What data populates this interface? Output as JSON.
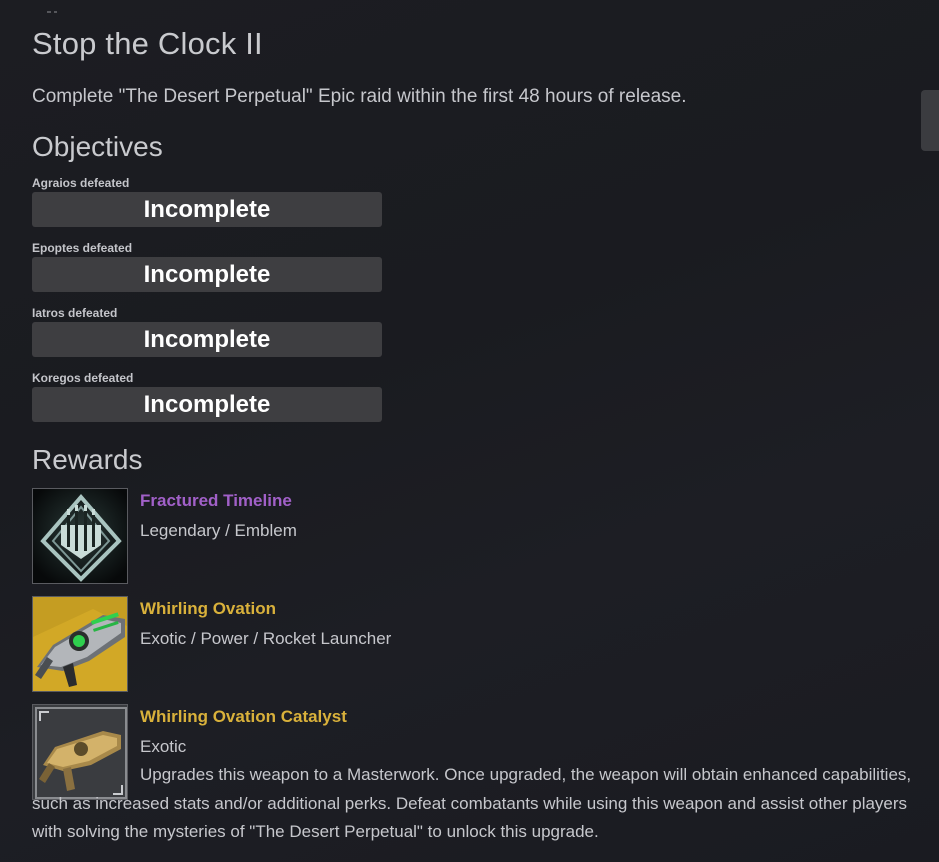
{
  "title": "Stop the Clock II",
  "description": "Complete \"The Desert Perpetual\" Epic raid within the first 48 hours of release.",
  "objectives": {
    "heading": "Objectives",
    "items": [
      {
        "label": "Agraios defeated",
        "status": "Incomplete"
      },
      {
        "label": "Epoptes defeated",
        "status": "Incomplete"
      },
      {
        "label": "Iatros defeated",
        "status": "Incomplete"
      },
      {
        "label": "Koregos defeated",
        "status": "Incomplete"
      }
    ]
  },
  "rewards": {
    "heading": "Rewards",
    "items": [
      {
        "name": "Fractured Timeline",
        "type": "Legendary / Emblem",
        "name_color": "#a160c8",
        "icon": "emblem-icon"
      },
      {
        "name": "Whirling Ovation",
        "type": "Exotic / Power / Rocket Launcher",
        "name_color": "#d9b13b",
        "icon": "rocket-launcher-icon"
      },
      {
        "name": "Whirling Ovation Catalyst",
        "type": "Exotic",
        "name_color": "#d9b13b",
        "icon": "catalyst-icon",
        "description": "Upgrades this weapon to a Masterwork. Once upgraded, the weapon will obtain enhanced capabilities, such as increased stats and/or additional perks. Defeat combatants while using this weapon and assist other players with solving the mysteries of \"The Desert Perpetual\" to unlock this upgrade."
      }
    ]
  },
  "colors": {
    "background": "#1c1d22",
    "objective_bar": "#3e3e41",
    "legendary": "#a160c8",
    "exotic": "#d9b13b"
  }
}
